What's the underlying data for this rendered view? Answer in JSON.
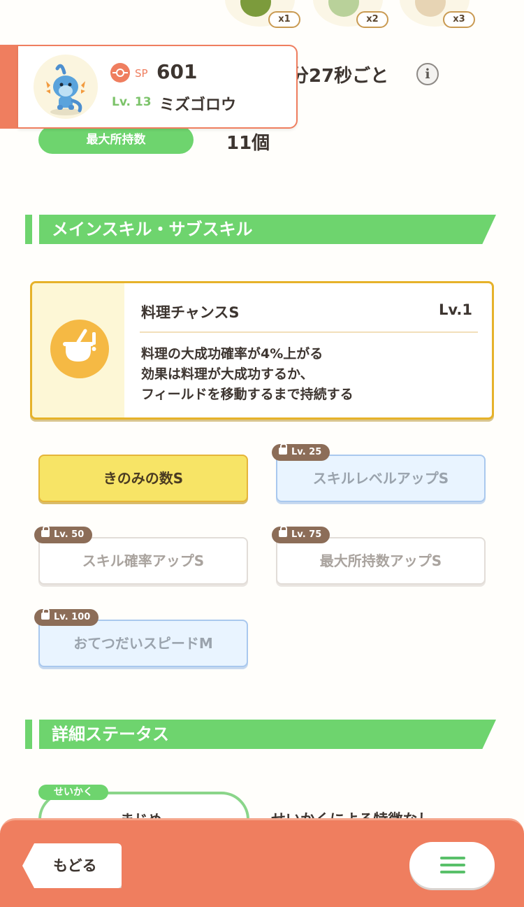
{
  "ingredients": [
    {
      "count": "x1",
      "color": "#9fb84e"
    },
    {
      "count": "x2",
      "color": "#b9d19a"
    },
    {
      "count": "x3",
      "color": "#e7d4b4"
    }
  ],
  "pokemon": {
    "sp_label": "SP",
    "sp_value": "601",
    "level_label": "Lv. 13",
    "name": "ミズゴロウ"
  },
  "help_frequency": "分27秒ごと",
  "max_capacity": {
    "label": "最大所持数",
    "value": "11個"
  },
  "sections": {
    "skills_title": "メインスキル・サブスキル",
    "details_title": "詳細ステータス"
  },
  "main_skill": {
    "name": "料理チャンスS",
    "level": "Lv.1",
    "description": [
      "料理の大成功確率が4%上がる",
      "効果は料理が大成功するか、",
      "フィールドを移動するまで持続する"
    ]
  },
  "sub_skills": [
    {
      "label": "きのみの数S",
      "lock_level": ""
    },
    {
      "label": "スキルレベルアップS",
      "lock_level": "Lv. 25"
    },
    {
      "label": "スキル確率アップS",
      "lock_level": "Lv. 50"
    },
    {
      "label": "最大所持数アップS",
      "lock_level": "Lv. 75"
    },
    {
      "label": "おてつだいスピードM",
      "lock_level": "Lv. 100"
    }
  ],
  "nature": {
    "tag": "せいかく",
    "name": "まじめ",
    "effect": "せいかくによる特徴なし"
  },
  "nav": {
    "back_label": "もどる"
  },
  "colors": {
    "accent": "#ef7e5f",
    "green": "#6ed46e",
    "gold": "#e6b22a"
  }
}
